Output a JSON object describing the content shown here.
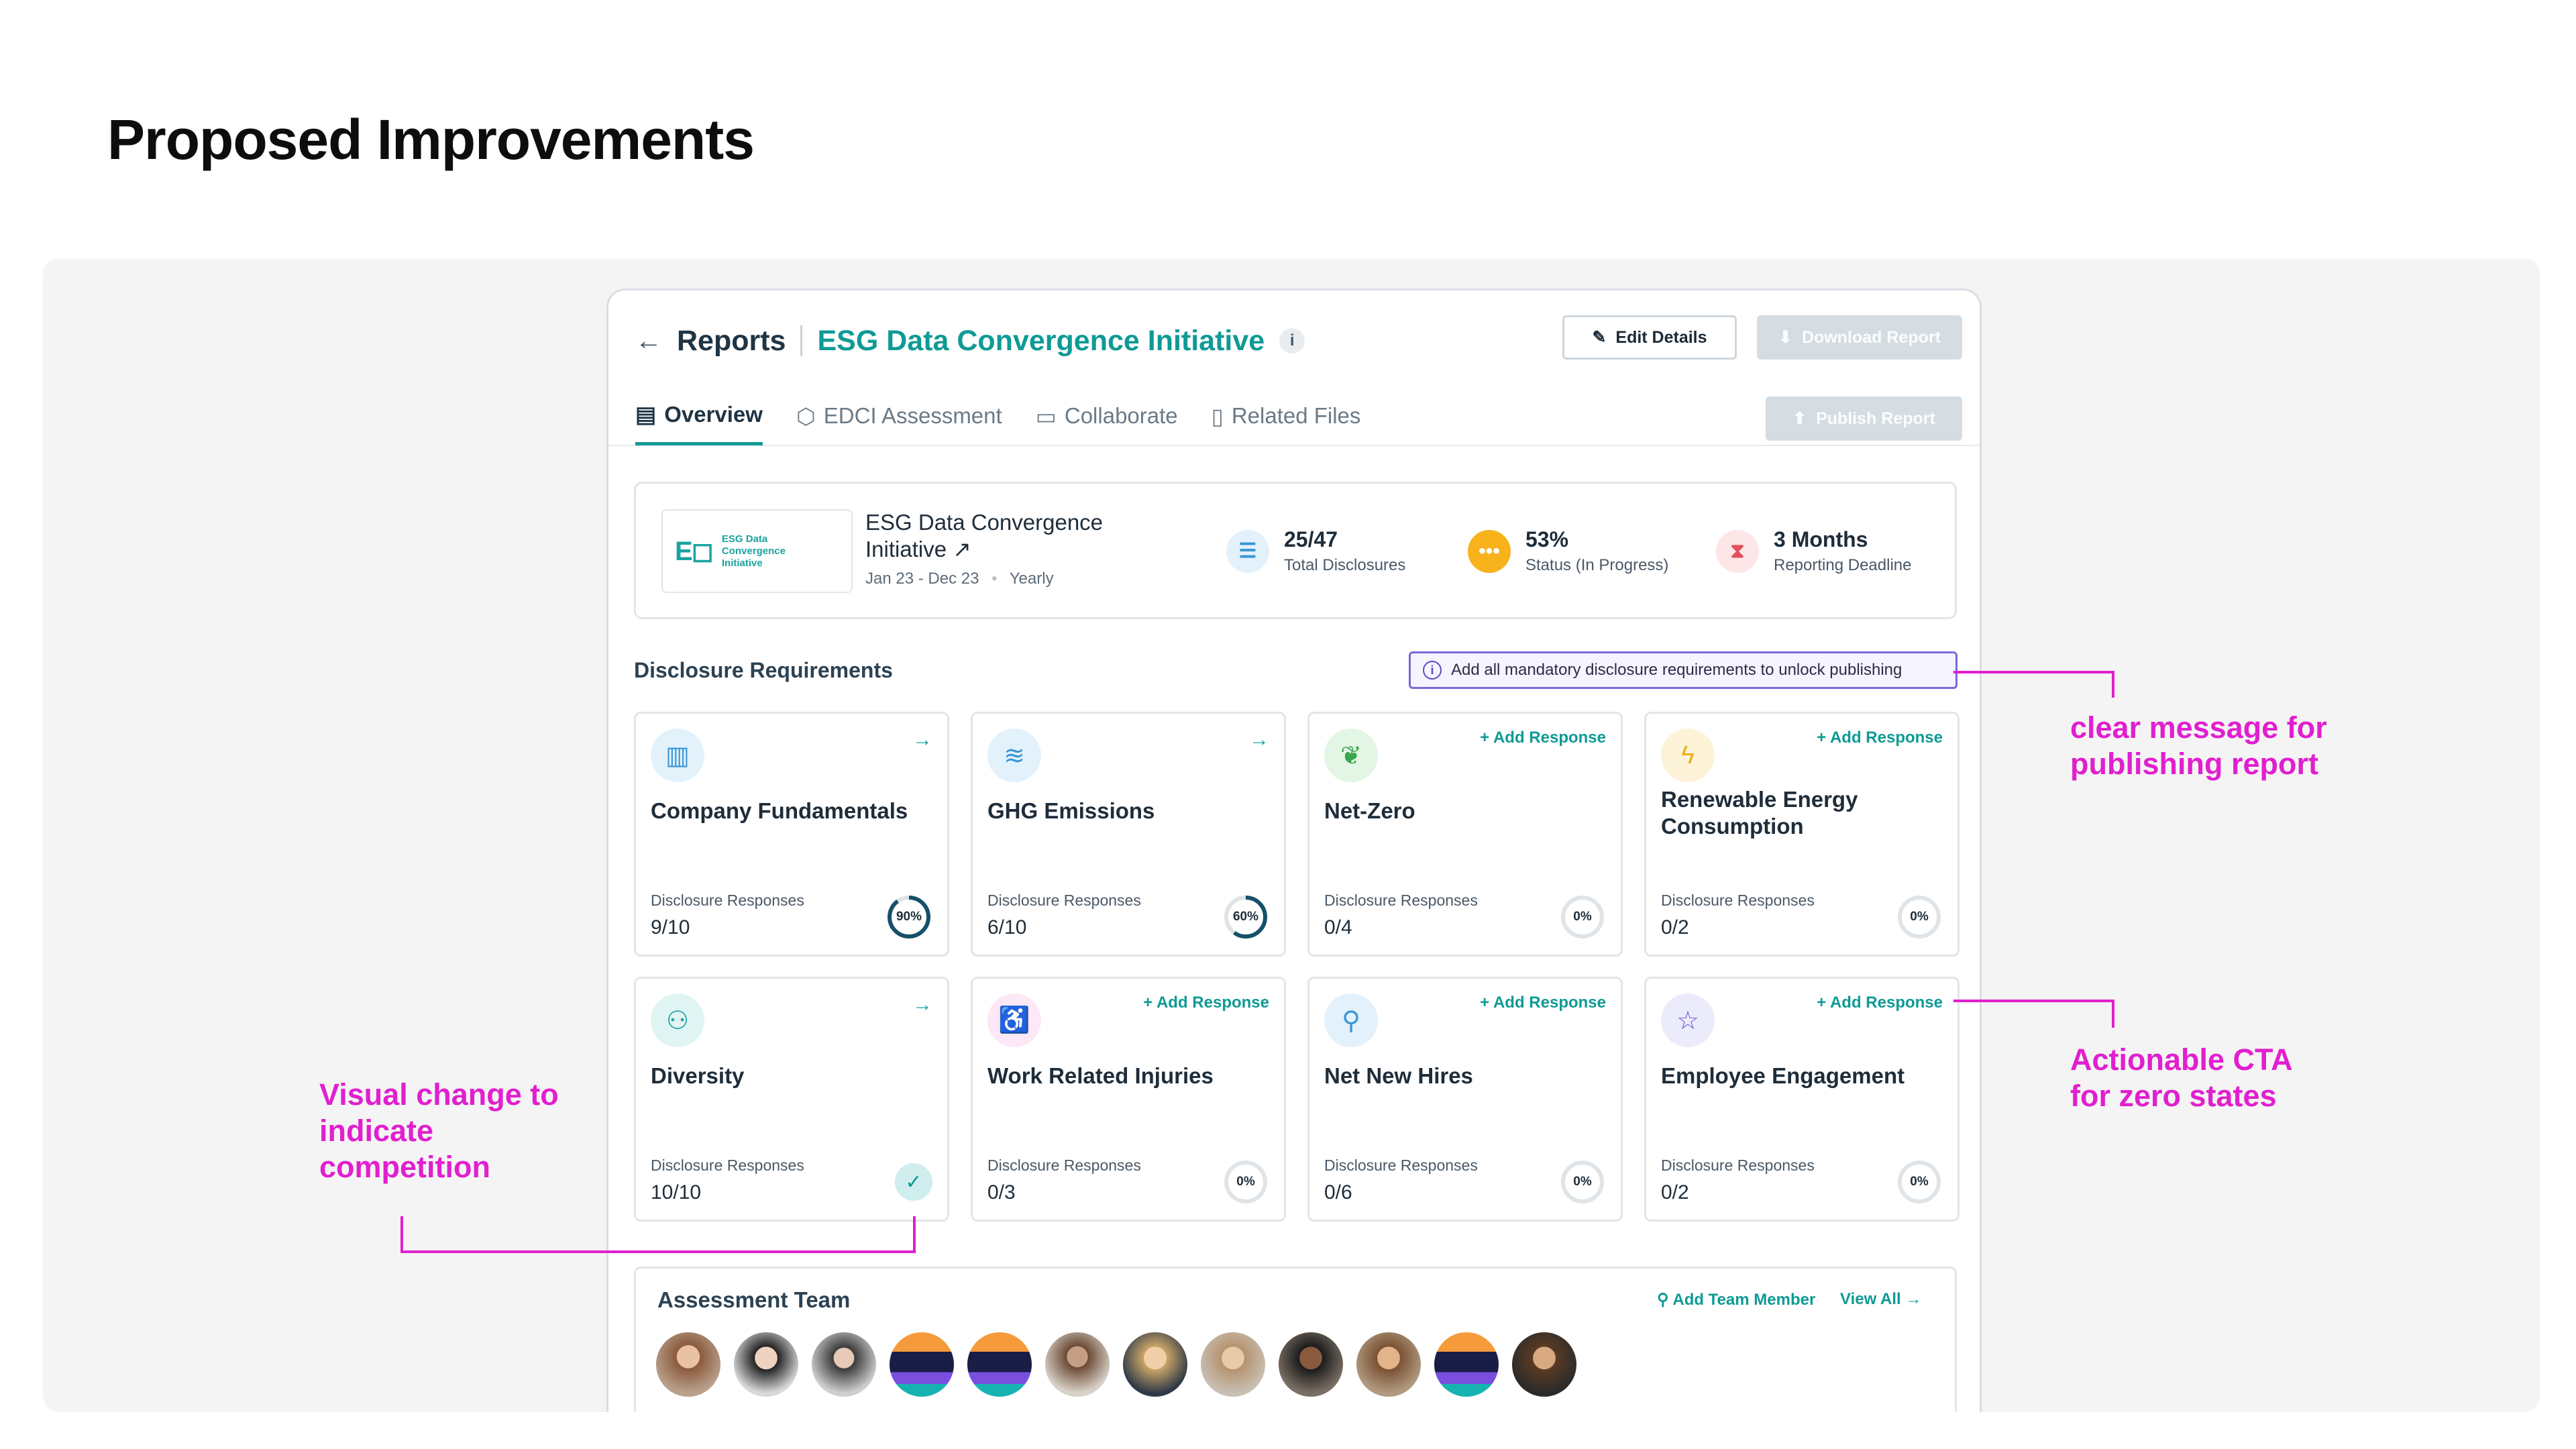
{
  "page_title": "Proposed Improvements",
  "header": {
    "crumb": "Reports",
    "report_name": "ESG Data Convergence Initiative",
    "info": "i",
    "edit_label": "Edit Details",
    "download_label": "Download Report",
    "publish_label": "Publish Report"
  },
  "tabs": [
    "Overview",
    "EDCI Assessment",
    "Collaborate",
    "Related Files"
  ],
  "summary": {
    "logo_text": "ESG Data Convergence Initiative",
    "title": "ESG Data Convergence Initiative ↗",
    "period": "Jan 23 - Dec 23",
    "sep": "•",
    "frequency": "Yearly",
    "stats": [
      {
        "value": "25/47",
        "label": "Total Disclosures"
      },
      {
        "value": "53%",
        "label": "Status (In Progress)"
      },
      {
        "value": "3 Months",
        "label": "Reporting Deadline"
      }
    ]
  },
  "disclosure": {
    "title": "Disclosure Requirements",
    "notice": "Add all mandatory disclosure requirements to unlock publishing",
    "resp_label": "Disclosure Responses",
    "add_label": "+ Add Response",
    "cards": [
      {
        "title": "Company Fundamentals",
        "value": "9/10",
        "pct": "90%",
        "progress": 0.9
      },
      {
        "title": "GHG Emissions",
        "value": "6/10",
        "pct": "60%",
        "progress": 0.6
      },
      {
        "title": "Net-Zero",
        "value": "0/4",
        "pct": "0%",
        "progress": 0
      },
      {
        "title": "Renewable Energy Consumption",
        "value": "0/2",
        "pct": "0%",
        "progress": 0
      },
      {
        "title": "Diversity",
        "value": "10/10",
        "pct": "",
        "progress": 1
      },
      {
        "title": "Work Related Injuries",
        "value": "0/3",
        "pct": "0%",
        "progress": 0
      },
      {
        "title": "Net New Hires",
        "value": "0/6",
        "pct": "0%",
        "progress": 0
      },
      {
        "title": "Employee Engagement",
        "value": "0/2",
        "pct": "0%",
        "progress": 0
      }
    ]
  },
  "team": {
    "title": "Assessment Team",
    "add_member": "Add Team Member",
    "view_all": "View All →"
  },
  "annotations": {
    "publishing": "clear message for publishing report",
    "cta": "Actionable CTA for zero states",
    "visual": "Visual change to indicate competition"
  },
  "colors": {
    "accent": "#0f9a95",
    "annotation": "#e11fcf",
    "notice_border": "#7b68d9"
  }
}
